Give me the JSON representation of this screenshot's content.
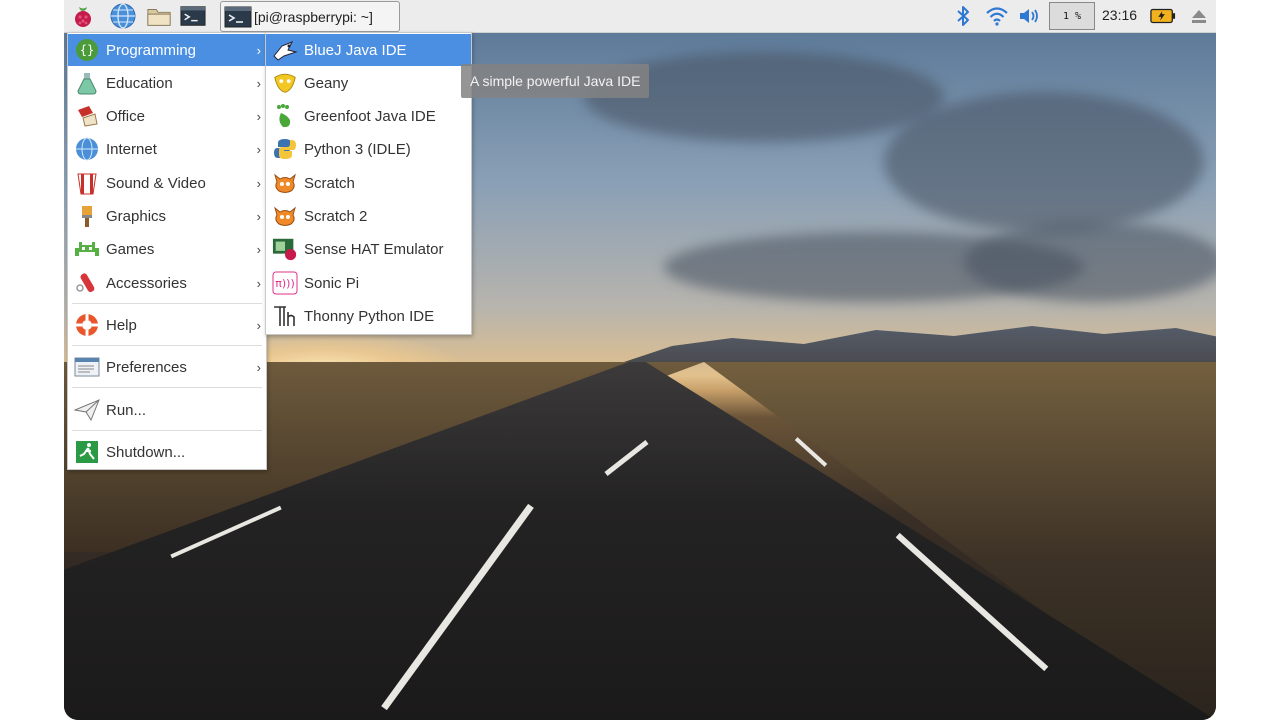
{
  "taskbar": {
    "launchers": [
      {
        "icon": "raspberry-icon"
      },
      {
        "icon": "web-browser-icon"
      },
      {
        "icon": "file-manager-icon"
      },
      {
        "icon": "terminal-icon"
      }
    ],
    "terminal_window": {
      "icon": "terminal-icon",
      "label": "[pi@raspberrypi: ~]"
    },
    "tray": {
      "cpu_usage": "1 %",
      "clock": "23:16",
      "icons": [
        "bluetooth-icon",
        "wifi-icon",
        "volume-icon",
        "battery-charging-icon",
        "eject-icon"
      ]
    }
  },
  "main_menu": {
    "items": [
      {
        "label": "Programming",
        "icon": "programming-icon",
        "has_submenu": true,
        "selected": true
      },
      {
        "label": "Education",
        "icon": "education-icon",
        "has_submenu": true
      },
      {
        "label": "Office",
        "icon": "office-icon",
        "has_submenu": true
      },
      {
        "label": "Internet",
        "icon": "internet-icon",
        "has_submenu": true
      },
      {
        "label": "Sound & Video",
        "icon": "sound-video-icon",
        "has_submenu": true
      },
      {
        "label": "Graphics",
        "icon": "graphics-icon",
        "has_submenu": true
      },
      {
        "label": "Games",
        "icon": "games-icon",
        "has_submenu": true
      },
      {
        "label": "Accessories",
        "icon": "accessories-icon",
        "has_submenu": true
      },
      {
        "label": "Help",
        "icon": "help-icon",
        "has_submenu": true
      },
      {
        "label": "Preferences",
        "icon": "preferences-icon",
        "has_submenu": true
      },
      {
        "label": "Run...",
        "icon": "run-icon",
        "has_submenu": false
      },
      {
        "label": "Shutdown...",
        "icon": "shutdown-icon",
        "has_submenu": false
      }
    ],
    "submenu_arrow": "›"
  },
  "programming_submenu": {
    "items": [
      {
        "label": "BlueJ Java IDE",
        "icon": "bluej-icon",
        "selected": true
      },
      {
        "label": "Geany",
        "icon": "geany-icon"
      },
      {
        "label": "Greenfoot Java IDE",
        "icon": "greenfoot-icon"
      },
      {
        "label": "Python 3 (IDLE)",
        "icon": "python-icon"
      },
      {
        "label": "Scratch",
        "icon": "scratch-icon"
      },
      {
        "label": "Scratch 2",
        "icon": "scratch2-icon"
      },
      {
        "label": "Sense HAT Emulator",
        "icon": "sense-hat-icon"
      },
      {
        "label": "Sonic Pi",
        "icon": "sonic-pi-icon"
      },
      {
        "label": "Thonny Python IDE",
        "icon": "thonny-icon"
      }
    ]
  },
  "tooltip": {
    "text": "A simple powerful Java IDE"
  },
  "colors": {
    "selection": "#4b8fe3",
    "taskbar": "#ececec",
    "menu_bg": "#ffffff"
  }
}
